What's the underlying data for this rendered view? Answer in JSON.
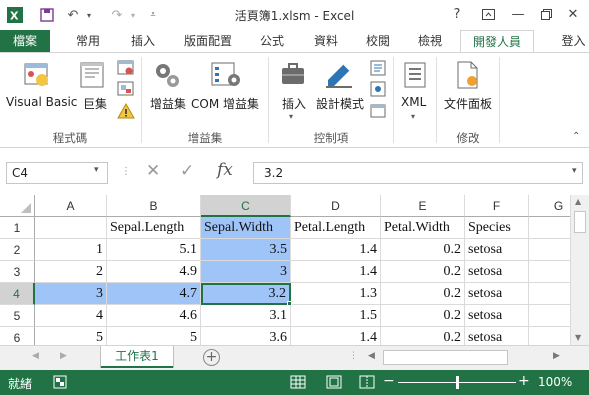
{
  "window": {
    "title": "活頁簿1.xlsm - Excel",
    "help": "?",
    "minimize": "—",
    "close": "✕"
  },
  "tabs": [
    "檔案",
    "常用",
    "插入",
    "版面配置",
    "公式",
    "資料",
    "校閱",
    "檢視",
    "開發人員"
  ],
  "signin": "登入",
  "ribbon": {
    "groups": [
      {
        "label": "程式碼",
        "buttons": [
          "Visual Basic",
          "巨集"
        ]
      },
      {
        "label": "增益集",
        "buttons": [
          "增益集",
          "COM 增益集"
        ]
      },
      {
        "label": "控制項",
        "buttons": [
          "插入",
          "設計模式"
        ]
      },
      {
        "label": "",
        "buttons": [
          "XML"
        ]
      },
      {
        "label": "修改",
        "buttons": [
          "文件面板"
        ]
      }
    ]
  },
  "formula_bar": {
    "name_box": "C4",
    "fx": "fx",
    "value": "3.2"
  },
  "grid": {
    "columns": [
      "A",
      "B",
      "C",
      "D",
      "E",
      "F",
      "G"
    ],
    "rows": [
      [
        "",
        "Sepal.Length",
        "Sepal.Width",
        "Petal.Length",
        "Petal.Width",
        "Species"
      ],
      [
        "1",
        "5.1",
        "3.5",
        "1.4",
        "0.2",
        "setosa"
      ],
      [
        "2",
        "4.9",
        "3",
        "1.4",
        "0.2",
        "setosa"
      ],
      [
        "3",
        "4.7",
        "3.2",
        "1.3",
        "0.2",
        "setosa"
      ],
      [
        "4",
        "4.6",
        "3.1",
        "1.5",
        "0.2",
        "setosa"
      ],
      [
        "5",
        "5",
        "3.6",
        "1.4",
        "0.2",
        "setosa"
      ]
    ],
    "row_numbers": [
      "1",
      "2",
      "3",
      "4",
      "5",
      "6"
    ],
    "active_cell": "C4",
    "selected_column": "C",
    "selected_row": "4"
  },
  "sheets": [
    "工作表1"
  ],
  "status": {
    "ready": "就緒",
    "zoom": "100%"
  },
  "colors": {
    "accent": "#217346",
    "selection": "#9fc5f8"
  }
}
